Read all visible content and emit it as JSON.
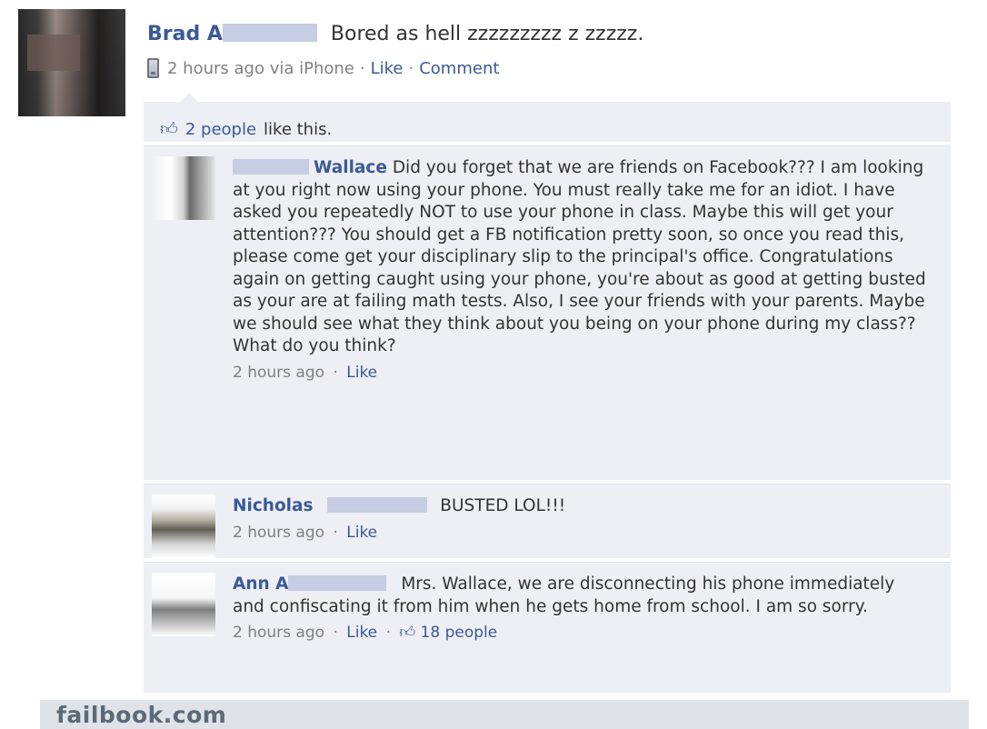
{
  "post": {
    "author_first": "Brad A",
    "status_text": "Bored as hell zzzzzzzzz z zzzzz.",
    "time": "2 hours ago via iPhone",
    "sep": "·",
    "like_link": "Like",
    "comment_link": "Comment"
  },
  "likes": {
    "count_text": "2 people",
    "suffix": "like this."
  },
  "comments": [
    {
      "name": "Wallace",
      "text": "Did you forget that we are friends on Facebook??? I am looking at you right now using your phone. You must really take me for an idiot. I have asked you repeatedly NOT to use your phone in class. Maybe this will get your attention??? You should get a FB notification pretty soon, so once you read this, please come get your disciplinary slip to the principal's office. Congratulations again on getting caught using your phone, you're about as good at getting busted as your are at failing math tests. Also, I see your friends with your parents. Maybe we should see what they think about you being on your phone during my class?? What do you think?",
      "time": "2 hours ago",
      "like_link": "Like"
    },
    {
      "name": "Nicholas",
      "text": "BUSTED LOL!!!",
      "time": "2 hours ago",
      "like_link": "Like"
    },
    {
      "name": "Ann A",
      "text": "Mrs. Wallace, we are disconnecting his phone immediately and confiscating it from him when he gets home from school. I am so sorry.",
      "time": "2 hours ago",
      "like_link": "Like",
      "likes": "18 people"
    }
  ],
  "footer": {
    "site": "failbook.com"
  }
}
